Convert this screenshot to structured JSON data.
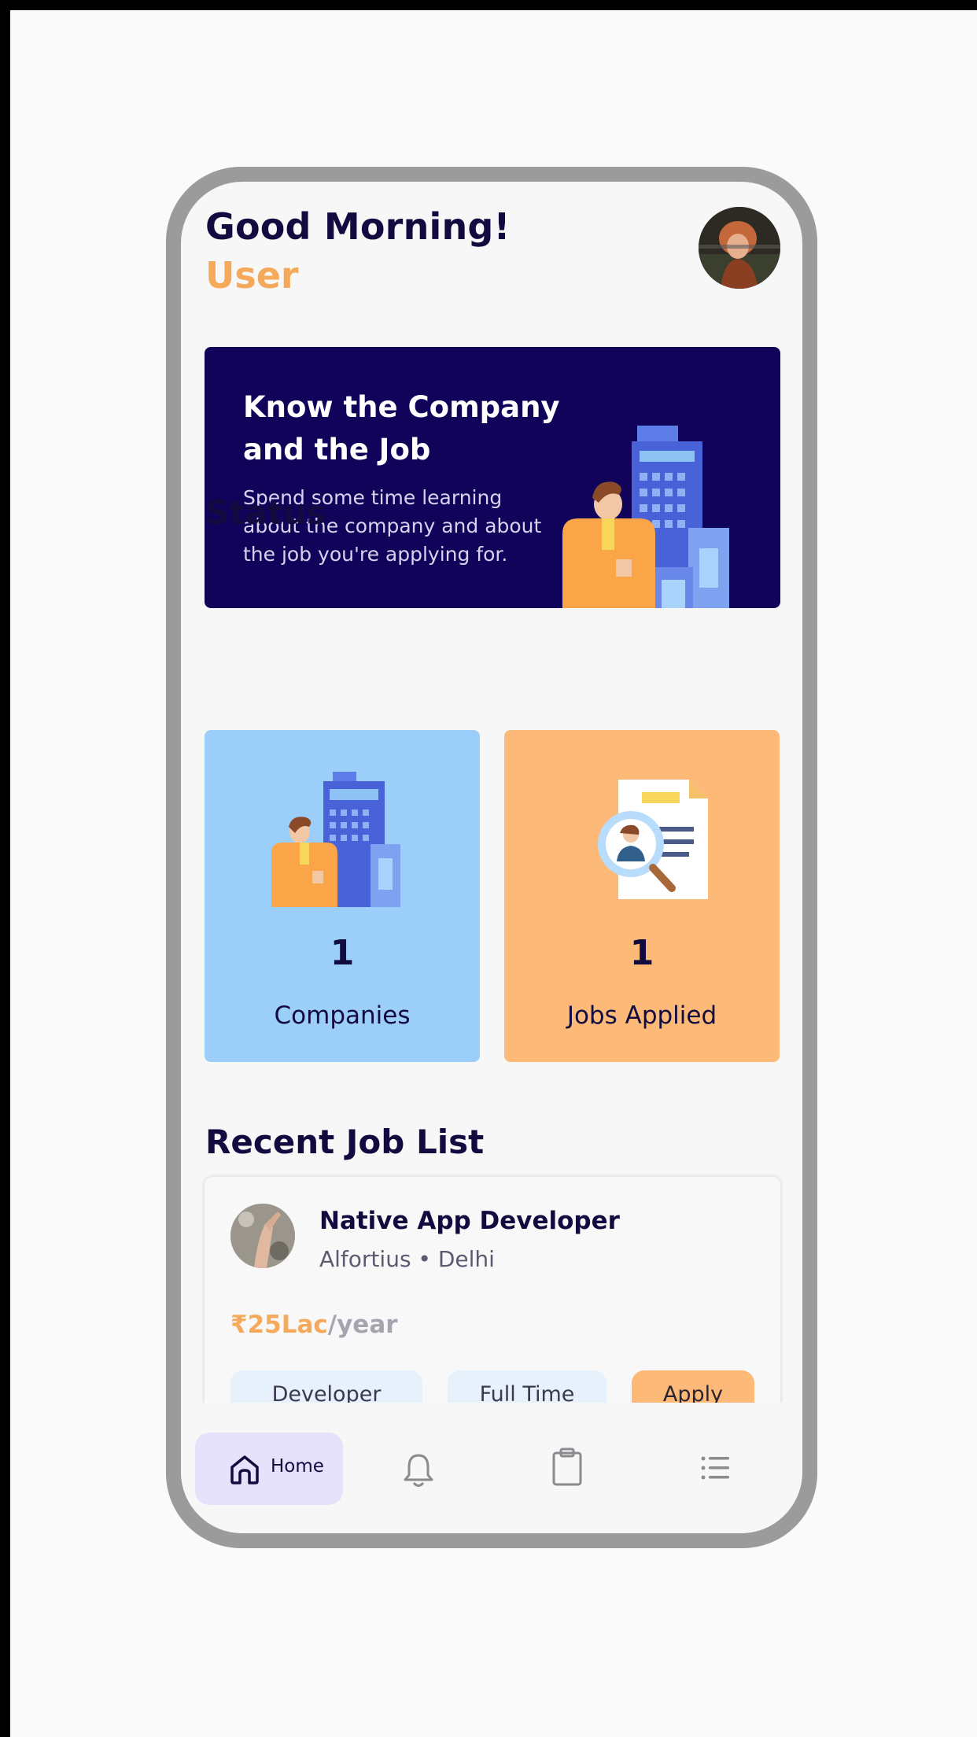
{
  "header": {
    "greeting": "Good Morning!",
    "username": "User"
  },
  "banner": {
    "title": "Know the Company and the Job",
    "text": "Spend some time learning about the company and about the job you're applying for."
  },
  "status": {
    "title": "Status",
    "cards": [
      {
        "count": "1",
        "label": "Companies",
        "color": "#9bcffa"
      },
      {
        "count": "1",
        "label": "Jobs Applied",
        "color": "#fdb978"
      }
    ]
  },
  "recent": {
    "title": "Recent Job List",
    "jobs": [
      {
        "title": "Native App Developer",
        "meta": "Alfortius • Delhi",
        "salary_amount": "₹25Lac",
        "salary_period": "/year",
        "tags": [
          "Developer",
          "Full Time"
        ],
        "apply_label": "Apply"
      }
    ]
  },
  "nav": {
    "items": [
      {
        "label": "Home",
        "icon": "home-icon",
        "active": true
      },
      {
        "label": "",
        "icon": "bell-icon"
      },
      {
        "label": "",
        "icon": "clipboard-icon"
      },
      {
        "label": "",
        "icon": "list-icon"
      }
    ]
  },
  "colors": {
    "navy": "#120b3f",
    "accent_orange": "#f5a95a",
    "banner_bg": "#11035a",
    "active_nav": "#e6e2fb"
  }
}
